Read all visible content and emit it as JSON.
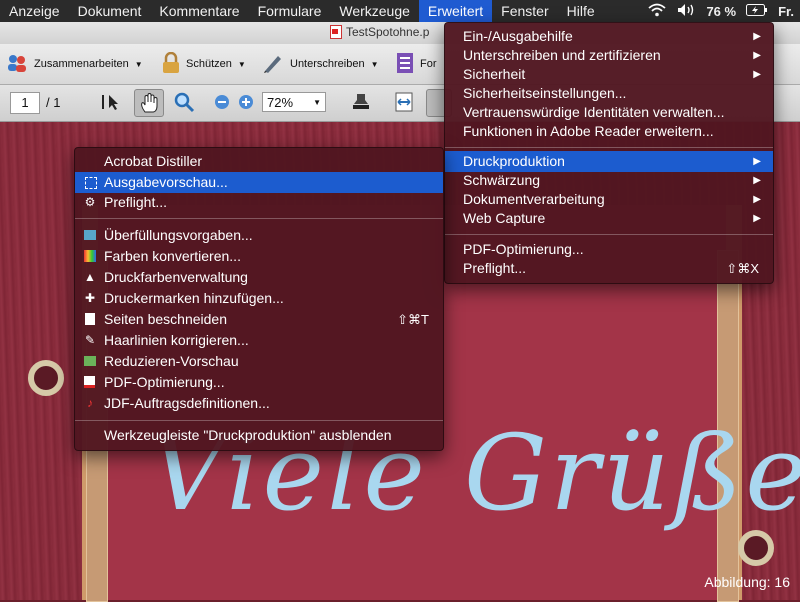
{
  "menubar": {
    "items": [
      "Anzeige",
      "Dokument",
      "Kommentare",
      "Formulare",
      "Werkzeuge",
      "Erweitert",
      "Fenster",
      "Hilfe"
    ],
    "battery": "76 %",
    "clock": "Fr."
  },
  "window": {
    "title": "TestSpotohne.p"
  },
  "toolbar1": {
    "collaborate": "Zusammenarbeiten",
    "protect": "Schützen",
    "sign": "Unterschreiben",
    "forms": "For"
  },
  "toolbar2": {
    "page": "1",
    "page_total": "/ 1",
    "zoom": "72%"
  },
  "advanced_menu": {
    "items": [
      "Ein-/Ausgabehilfe",
      "Unterschreiben und zertifizieren",
      "Sicherheit",
      "Sicherheitseinstellungen...",
      "Vertrauenswürdige Identitäten verwalten...",
      "Funktionen in Adobe Reader erweitern...",
      "Druckproduktion",
      "Schwärzung",
      "Dokumentverarbeitung",
      "Web Capture",
      "PDF-Optimierung...",
      "Preflight..."
    ],
    "preflight_shortcut": "⇧⌘X"
  },
  "print_menu": {
    "items": [
      "Acrobat Distiller",
      "Ausgabevorschau...",
      "Preflight...",
      "Überfüllungsvorgaben...",
      "Farben konvertieren...",
      "Druckfarbenverwaltung",
      "Druckermarken hinzufügen...",
      "Seiten beschneiden",
      "Haarlinien korrigieren...",
      "Reduzieren-Vorschau",
      "PDF-Optimierung...",
      "JDF-Auftragsdefinitionen...",
      "Werkzeugleiste \"Druckproduktion\" ausblenden"
    ],
    "crop_shortcut": "⇧⌘T"
  },
  "document": {
    "greeting": "Viele Grüße"
  },
  "figure_label": "Abbildung: 16",
  "colors": {
    "highlight": "#1c5ccf",
    "menubar": "#2b2b2b",
    "background": "#8b2d3d"
  }
}
